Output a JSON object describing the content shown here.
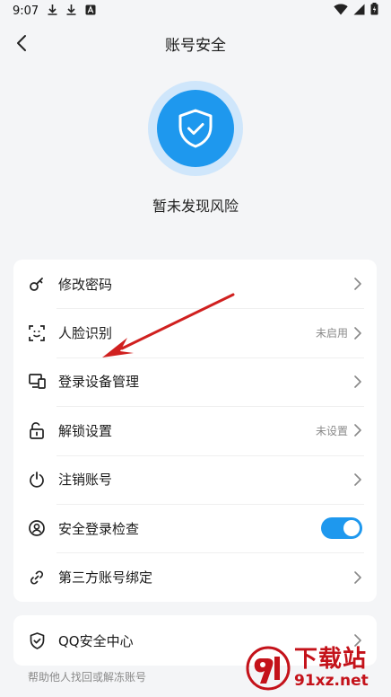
{
  "status_bar": {
    "time": "9:07"
  },
  "nav": {
    "title": "账号安全"
  },
  "hero": {
    "status_text": "暂未发现风险"
  },
  "security_items": [
    {
      "label": "修改密码",
      "icon": "key-icon",
      "value": ""
    },
    {
      "label": "人脸识别",
      "icon": "face-scan-icon",
      "value": "未启用"
    },
    {
      "label": "登录设备管理",
      "icon": "devices-icon",
      "value": ""
    },
    {
      "label": "解锁设置",
      "icon": "unlock-icon",
      "value": "未设置"
    },
    {
      "label": "注销账号",
      "icon": "power-icon",
      "value": ""
    },
    {
      "label": "安全登录检查",
      "icon": "user-circle-icon",
      "toggle": true
    },
    {
      "label": "第三方账号绑定",
      "icon": "link-icon",
      "value": ""
    }
  ],
  "qq_center": {
    "label": "QQ安全中心",
    "icon": "shield-check-icon"
  },
  "footer": {
    "text": "帮助他人找回或解冻账号"
  },
  "watermark": {
    "cn": "下载站",
    "en": "91xz.net"
  },
  "colors": {
    "accent": "#1e98ee",
    "shield_ring": "#cfe6fb",
    "annotation_arrow": "#d0201f",
    "watermark": "#c4121a"
  }
}
